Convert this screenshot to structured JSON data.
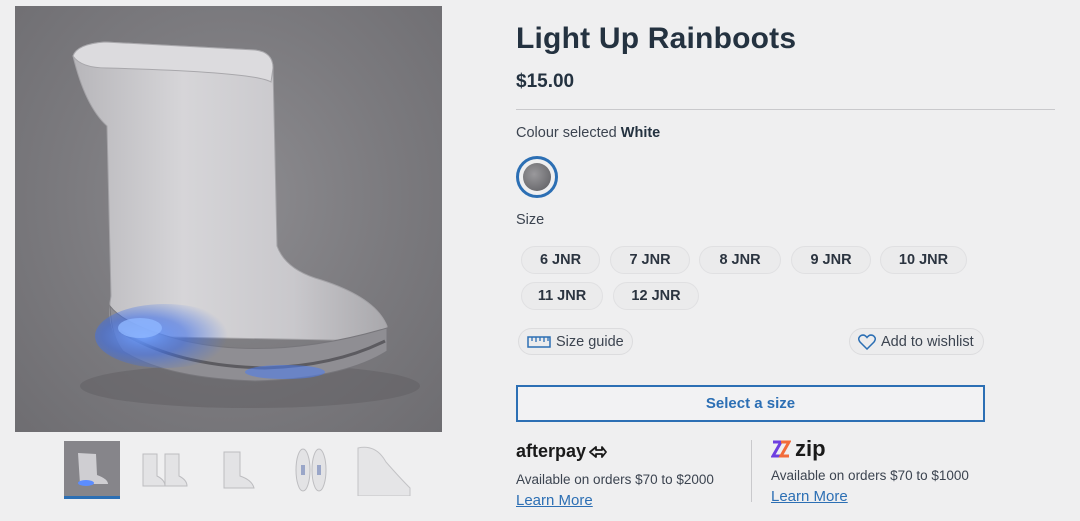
{
  "product": {
    "title": "Light Up Rainboots",
    "price": "$15.00",
    "colour_label": "Colour selected",
    "colour_value": "White",
    "size_label": "Size",
    "sizes": [
      "6 JNR",
      "7 JNR",
      "8 JNR",
      "9 JNR",
      "10 JNR",
      "11 JNR",
      "12 JNR"
    ]
  },
  "actions": {
    "size_guide": "Size guide",
    "wishlist": "Add to wishlist",
    "select_size": "Select a size"
  },
  "payments": {
    "afterpay": {
      "logo": "afterpay",
      "text": "Available on orders $70 to $2000",
      "link": "Learn More"
    },
    "zip": {
      "logo": "zip",
      "text": "Available on orders $70 to $1000",
      "link": "Learn More"
    }
  },
  "gallery": {
    "thumbnail_count": 5,
    "active_index": 0
  },
  "colors": {
    "accent": "#2c6fb4",
    "text": "#243240",
    "background": "#efeff0",
    "led": "#3f7bff",
    "zip_purple": "#6e3fe0",
    "zip_orange": "#f26b3a"
  }
}
